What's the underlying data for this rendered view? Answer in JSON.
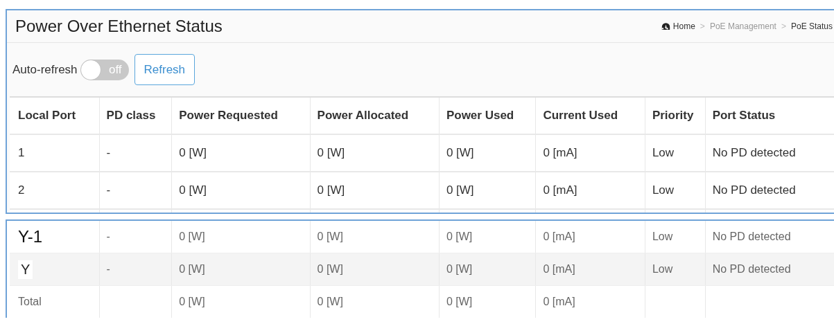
{
  "title": "Power Over Ethernet Status",
  "breadcrumb": [
    {
      "label": "Home",
      "kind": "home"
    },
    {
      "label": "PoE Management",
      "kind": "link"
    },
    {
      "label": "PoE Status",
      "kind": "current"
    }
  ],
  "breadcrumb_separator": ">",
  "auto_refresh": {
    "label": "Auto-refresh",
    "on": false,
    "state_text": "off"
  },
  "refresh_button": "Refresh",
  "table": {
    "columns": [
      "Local Port",
      "PD class",
      "Power Requested",
      "Power Allocated",
      "Power Used",
      "Current Used",
      "Priority",
      "Port Status"
    ],
    "rows": [
      [
        "1",
        "-",
        "0 [W]",
        "0 [W]",
        "0 [W]",
        "0 [mA]",
        "Low",
        "No PD detected"
      ],
      [
        "2",
        "-",
        "0 [W]",
        "0 [W]",
        "0 [W]",
        "0 [mA]",
        "Low",
        "No PD detected"
      ]
    ]
  },
  "continued_table": {
    "rows": [
      {
        "kind": "large",
        "cells": [
          "Y-1",
          "-",
          "0 [W]",
          "0 [W]",
          "0 [W]",
          "0 [mA]",
          "Low",
          "No PD detected"
        ]
      },
      {
        "kind": "pasted",
        "cells": [
          "Y",
          "-",
          "0 [W]",
          "0 [W]",
          "0 [W]",
          "0 [mA]",
          "Low",
          "No PD detected"
        ]
      },
      {
        "kind": "total",
        "cells": [
          "Total",
          null,
          "0 [W]",
          "0 [W]",
          "0 [W]",
          "0 [mA]",
          null,
          null
        ]
      }
    ]
  }
}
